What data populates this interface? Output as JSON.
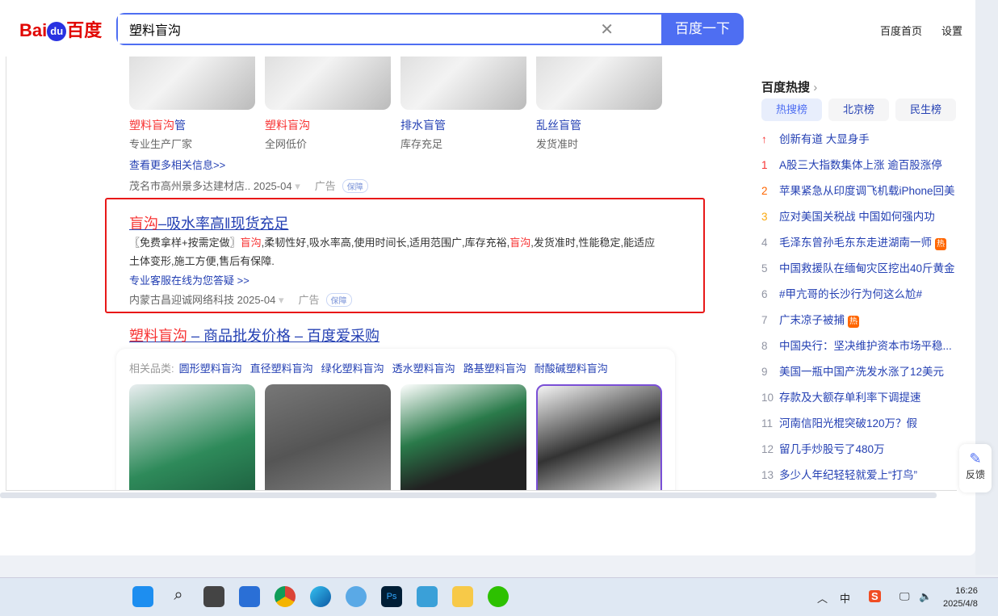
{
  "header": {
    "logo": "Bai百度",
    "logo_du": "du",
    "query": "塑料盲沟",
    "search_button": "百度一下",
    "links": [
      "百度首页",
      "设置"
    ]
  },
  "top_products": [
    {
      "name_hl": "塑料盲沟",
      "name_rest": "管",
      "sub": "专业生产厂家"
    },
    {
      "name_hl": "塑料盲沟",
      "name_rest": "",
      "sub": "全网低价"
    },
    {
      "name_hl": "",
      "name_rest": "排水盲管",
      "sub": "库存充足"
    },
    {
      "name_hl": "",
      "name_rest": "乱丝盲管",
      "sub": "发货准时"
    }
  ],
  "ad1": {
    "more": "查看更多相关信息>>",
    "source": "茂名市高州景多达建材店..",
    "date": "2025-04",
    "ad": "广告",
    "badge": "保障"
  },
  "ad2": {
    "title_hl": "盲沟",
    "title_rest": "–吸水率高‖现货充足",
    "desc_1": "〖免费拿样+按需定做〗",
    "desc_hl1": "盲沟",
    "desc_2": ",柔韧性好,吸水率高,使用时间长,适用范围广,库存充裕,",
    "desc_hl2": "盲沟",
    "desc_3": ",发货准时,性能稳定,能适应土体变形,施工方便,售后有保障.",
    "link": "专业客服在线为您答疑 >>",
    "source": "内蒙古昌迎诚网络科技",
    "date": "2025-04",
    "ad": "广告",
    "badge": "保障"
  },
  "result3": {
    "title_hl": "塑料盲沟",
    "title_rest": " – 商品批发价格 – 百度爱采购",
    "related_label": "相关品类:",
    "related": [
      "圆形塑料盲沟",
      "直径塑料盲沟",
      "绿化塑料盲沟",
      "透水塑料盲沟",
      "路基塑料盲沟",
      "耐酸碱塑料盲沟"
    ]
  },
  "hot": {
    "title": "百度热搜",
    "tabs": [
      "热搜榜",
      "北京榜",
      "民生榜"
    ],
    "items": [
      {
        "rank": "↑",
        "text": "创新有道 大显身手",
        "tag": ""
      },
      {
        "rank": "1",
        "text": "A股三大指数集体上涨 逾百股涨停",
        "tag": ""
      },
      {
        "rank": "2",
        "text": "苹果紧急从印度调飞机载iPhone回美",
        "tag": ""
      },
      {
        "rank": "3",
        "text": "应对美国关税战 中国如何强内功",
        "tag": ""
      },
      {
        "rank": "4",
        "text": "毛泽东曾孙毛东东走进湖南一师",
        "tag": "热"
      },
      {
        "rank": "5",
        "text": "中国救援队在缅甸灾区挖出40斤黄金",
        "tag": ""
      },
      {
        "rank": "6",
        "text": "#甲亢哥的长沙行为何这么尬#",
        "tag": ""
      },
      {
        "rank": "7",
        "text": "广末凉子被捕",
        "tag": "热"
      },
      {
        "rank": "8",
        "text": "中国央行：坚决维护资本市场平稳...",
        "tag": ""
      },
      {
        "rank": "9",
        "text": "美国一瓶中国产洗发水涨了12美元",
        "tag": ""
      },
      {
        "rank": "10",
        "text": "存款及大额存单利率下调提速",
        "tag": ""
      },
      {
        "rank": "11",
        "text": "河南信阳光棍突破120万？假",
        "tag": ""
      },
      {
        "rank": "12",
        "text": "留几手炒股亏了480万",
        "tag": ""
      },
      {
        "rank": "13",
        "text": "多少人年纪轻轻就爱上“打鸟”",
        "tag": ""
      }
    ]
  },
  "feedback": "反馈",
  "taskbar": {
    "time": "16:26",
    "date": "2025/4/8",
    "ime": "中",
    "sogou": "S"
  },
  "colors": {
    "accent": "#4e6ef2",
    "link": "#2440b3",
    "highlight": "#f73131"
  }
}
